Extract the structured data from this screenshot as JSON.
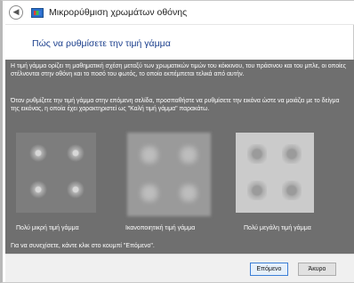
{
  "window": {
    "title": "Μικρορύθμιση χρωμάτων οθόνης",
    "back_icon": "back-arrow-icon",
    "app_icon": "display-color-icon"
  },
  "page": {
    "heading": "Πώς να ρυθμίσετε την τιμή γάμμα",
    "paragraph1": "Η τιμή γάμμα ορίζει τη μαθηματική σχέση μεταξύ των χρωματικών τιμών του κόκκινου, του πράσινου και του μπλε, οι οποίες στέλνονται στην οθόνη και το ποσό του φωτός, το οποίο εκπέμπεται τελικά από αυτήν.",
    "paragraph2": "Όταν ρυθμίζετε την τιμή γάμμα στην επόμενη σελίδα, προσπαθήστε να ρυθμίσετε την εικόνα ώστε να μοιάζει με το δείγμα της εικόνας, η οποία έχει χαρακτηριστεί ως \"Καλή τιμή γάμμα\" παρακάτω.",
    "samples": [
      {
        "caption": "Πολύ μικρή τιμή γάμμα"
      },
      {
        "caption": "Ικανοποιητική τιμή γάμμα"
      },
      {
        "caption": "Πολύ μεγάλη τιμή γάμμα"
      }
    ],
    "continue_note": "Για να συνεχίσετε, κάντε κλικ στο κουμπί \"Επόμενο\"."
  },
  "footer": {
    "next_label": "Επόμενο",
    "cancel_label": "Άκυρο"
  }
}
